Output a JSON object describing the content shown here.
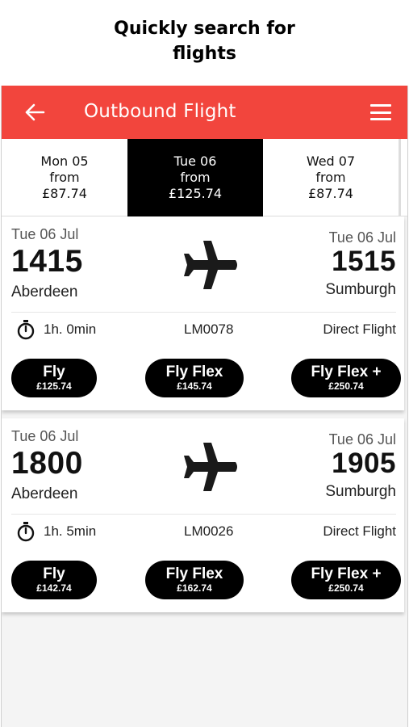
{
  "headline": {
    "line1": "Quickly search for",
    "line2": "flights"
  },
  "appbar": {
    "title": "Outbound Flight",
    "accent": "#f2453d",
    "back_icon": "arrow-left-icon",
    "menu_icon": "hamburger-menu-icon"
  },
  "date_tabs": [
    {
      "day": "Mon 05",
      "from": "from",
      "price": "£87.74",
      "active": false
    },
    {
      "day": "Tue 06",
      "from": "from",
      "price": "£125.74",
      "active": true
    },
    {
      "day": "Wed 07",
      "from": "from",
      "price": "£87.74",
      "active": false
    }
  ],
  "flights": [
    {
      "dep_date": "Tue 06 Jul",
      "dep_time": "1415",
      "dep_city": "Aberdeen",
      "arr_date": "Tue 06 Jul",
      "arr_time": "1515",
      "arr_city": "Sumburgh",
      "duration": "1h. 0min",
      "flight_no": "LM0078",
      "type": "Direct Flight",
      "fares": [
        {
          "name": "Fly",
          "price": "£125.74"
        },
        {
          "name": "Fly Flex",
          "price": "£145.74"
        },
        {
          "name": "Fly Flex +",
          "price": "£250.74"
        }
      ]
    },
    {
      "dep_date": "Tue 06 Jul",
      "dep_time": "1800",
      "dep_city": "Aberdeen",
      "arr_date": "Tue 06 Jul",
      "arr_time": "1905",
      "arr_city": "Sumburgh",
      "duration": "1h. 5min",
      "flight_no": "LM0026",
      "type": "Direct Flight",
      "fares": [
        {
          "name": "Fly",
          "price": "£142.74"
        },
        {
          "name": "Fly Flex",
          "price": "£162.74"
        },
        {
          "name": "Fly Flex +",
          "price": "£250.74"
        }
      ]
    }
  ]
}
